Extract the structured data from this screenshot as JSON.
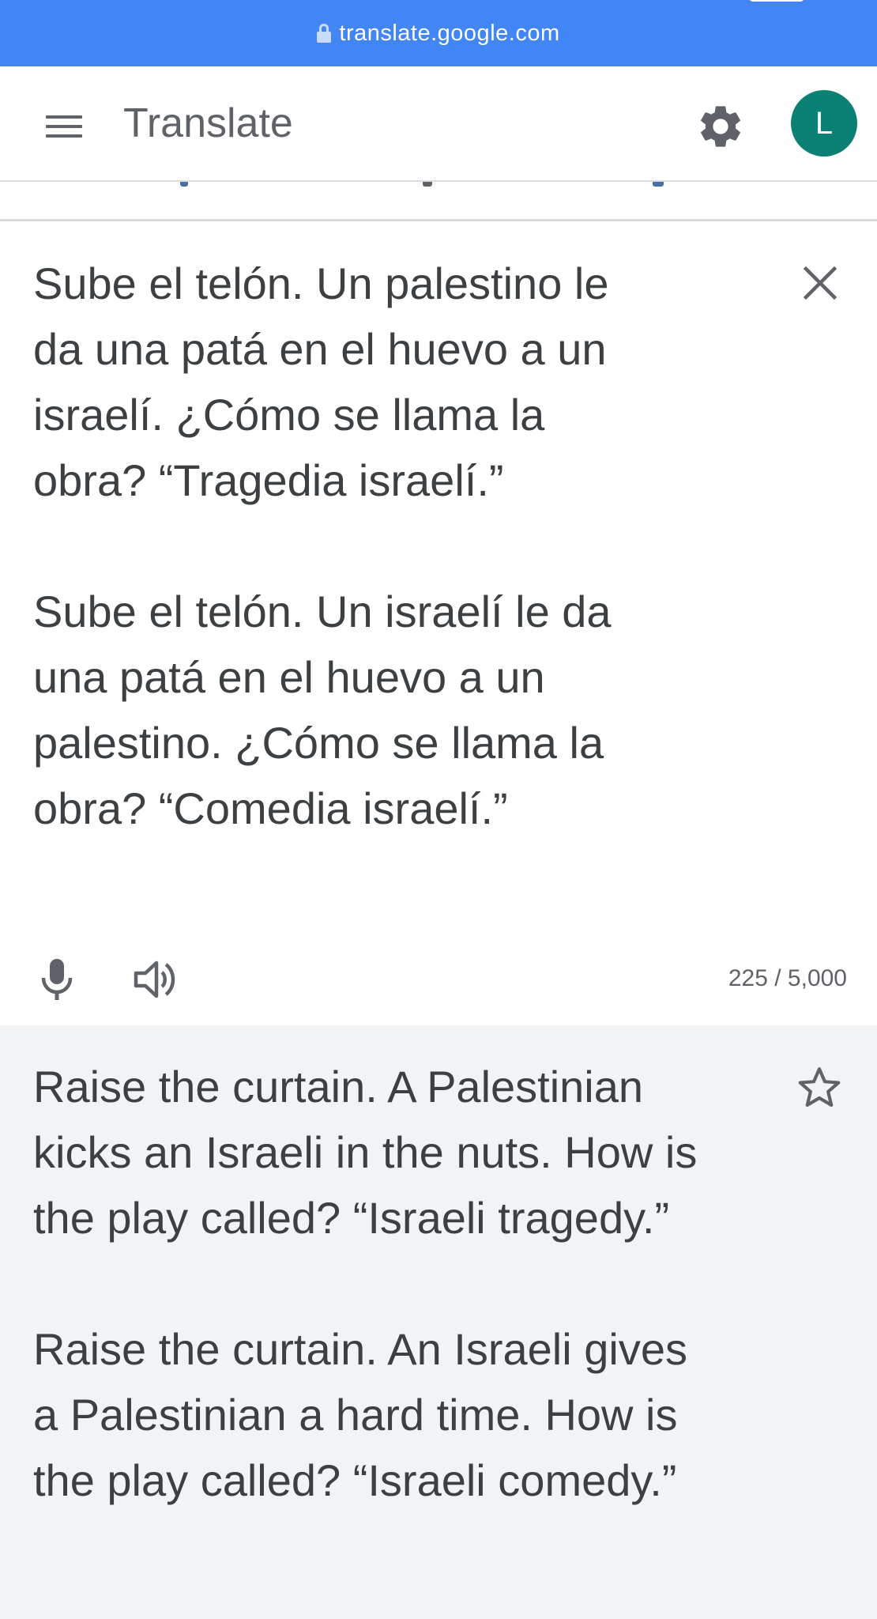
{
  "browser": {
    "url": "translate.google.com",
    "url_bar_color": "#4285f4"
  },
  "header": {
    "title": "Translate",
    "avatar_letter": "L",
    "avatar_color": "#0b8074"
  },
  "icons": {
    "menu": "hamburger-menu-icon",
    "settings": "gear-icon",
    "clear": "close-icon",
    "voice": "mic-icon",
    "listen": "speaker-icon",
    "save": "star-icon",
    "secure": "lock-icon"
  },
  "source": {
    "text": "Sube el telón. Un palestino le\nda una patá en el huevo a un\nisraelí. ¿Cómo se llama la\nobra? “Tragedia israelí.”\n\nSube el telón. Un israelí le da\nuna patá en el huevo a un\npalestino. ¿Cómo se llama la\nobra? “Comedia israelí.”",
    "char_count": "225 / 5,000"
  },
  "translation": {
    "text": "Raise the curtain. A Palestinian\nkicks an Israeli in the nuts. How is\nthe play called? “Israeli tragedy.”\n\nRaise the curtain. An Israeli gives\na Palestinian a hard time. How is\nthe play called? “Israeli comedy.”",
    "background": "#f1f3f4"
  }
}
